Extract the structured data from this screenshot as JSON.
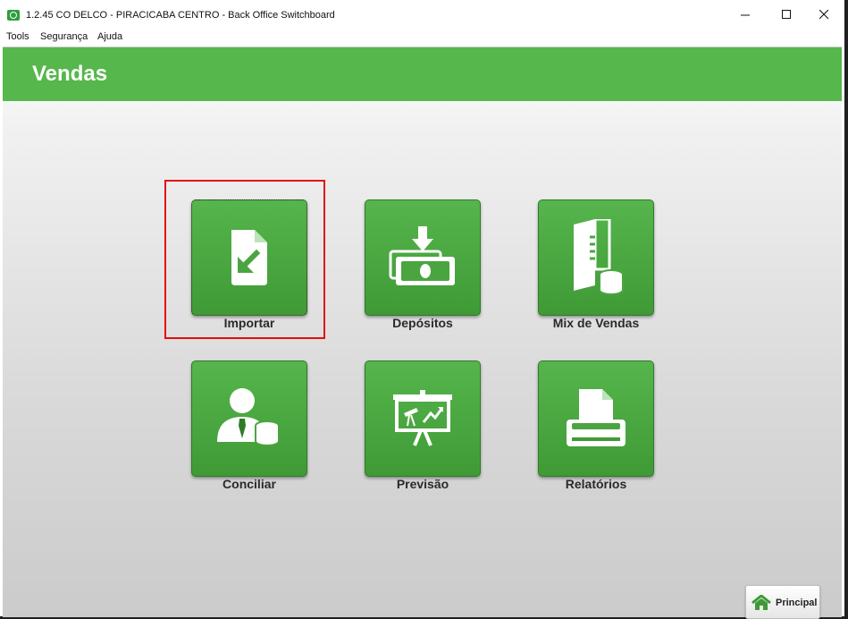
{
  "window": {
    "title": "1.2.45 CO DELCO - PIRACICABA CENTRO - Back Office Switchboard",
    "app_icon": "app-logo-icon",
    "controls": [
      "minimize-icon",
      "maximize-icon",
      "close-icon"
    ]
  },
  "menu": {
    "items": [
      {
        "label": "Tools"
      },
      {
        "label": "Segurança"
      },
      {
        "label": "Ajuda"
      }
    ]
  },
  "header": {
    "title": "Vendas",
    "color": "#56b74c"
  },
  "tiles": [
    {
      "label": "Importar",
      "icon": "import-document-icon",
      "selected": true
    },
    {
      "label": "Depósitos",
      "icon": "deposit-money-icon",
      "selected": false
    },
    {
      "label": "Mix de Vendas",
      "icon": "book-database-icon",
      "selected": false
    },
    {
      "label": "Conciliar",
      "icon": "user-database-icon",
      "selected": false
    },
    {
      "label": "Previsão",
      "icon": "presentation-chart-icon",
      "selected": false
    },
    {
      "label": "Relatórios",
      "icon": "printer-report-icon",
      "selected": false
    }
  ],
  "footer": {
    "principal_label": "Principal",
    "principal_icon": "home-icon"
  },
  "colors": {
    "tile_green": "#4caa42",
    "focus_red": "#e30d0d"
  }
}
